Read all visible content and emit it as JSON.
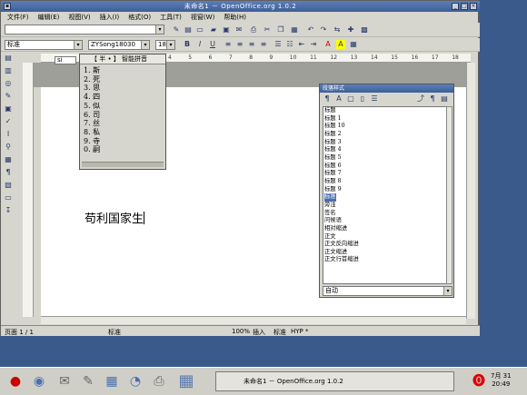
{
  "window": {
    "title": "未命名1 － OpenOffice.org 1.0.2"
  },
  "menu": [
    "文件(F)",
    "编辑(E)",
    "视图(V)",
    "插入(I)",
    "格式(O)",
    "工具(T)",
    "视窗(W)",
    "帮助(H)"
  ],
  "format_bar": {
    "style": "标准",
    "font": "ZYSong18030",
    "size": "18",
    "bold": "B",
    "italic": "I",
    "underline": "U"
  },
  "ruler": [
    "4",
    "5",
    "6",
    "7",
    "8",
    "9",
    "10",
    "11",
    "12",
    "13",
    "14",
    "15",
    "16",
    "17",
    "18"
  ],
  "ime": {
    "header": "【 半 • 】 智能拼音",
    "input": "si",
    "candidates": [
      "1. 斯",
      "2. 死",
      "3. 思",
      "4. 四",
      "5. 似",
      "6. 司",
      "7. 丝",
      "8. 私",
      "9. 寺",
      "0. 嗣"
    ]
  },
  "document": {
    "text": "苟利国家生"
  },
  "styles_panel": {
    "title": "段落样式",
    "items": [
      "标题",
      "标题 1",
      "标题 10",
      "标题 2",
      "标题 3",
      "标题 4",
      "标题 5",
      "标题 6",
      "标题 7",
      "标题 8",
      "标题 9",
      "标准",
      "旁注",
      "签名",
      "问候语",
      "相对缩进",
      "正文",
      "正文反向缩进",
      "正文缩进",
      "正文行首缩进"
    ],
    "selected_index": 11,
    "filter": "自动"
  },
  "status": {
    "page": "页面  1 / 1",
    "style": "标准",
    "zoom": "100%",
    "mode": "插入",
    "sel": "标准",
    "hyp": "HYP",
    "mod": "*"
  },
  "taskbar": {
    "task": "未命名1 － OpenOffice.org 1.0.2",
    "date": "7月  31",
    "time": "20:49"
  }
}
